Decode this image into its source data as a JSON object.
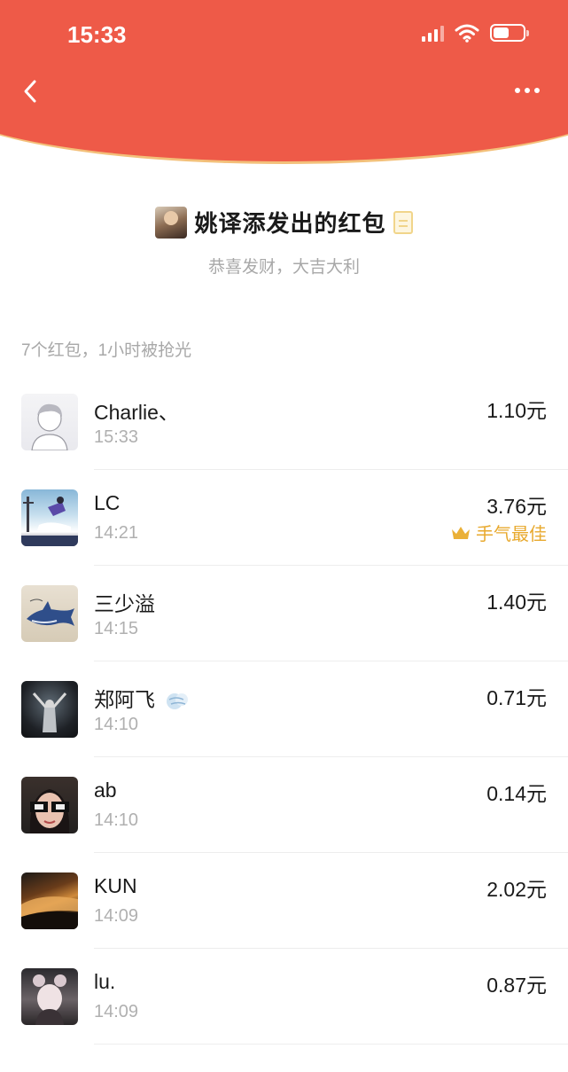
{
  "status_bar": {
    "time": "15:33"
  },
  "header": {
    "title": "姚译添发出的红包",
    "subtitle": "恭喜发财，大吉大利",
    "accent_color": "#ee5a48"
  },
  "summary": "7个红包，1小时被抢光",
  "best_label": "手气最佳",
  "records": [
    {
      "name": "Charlie、",
      "time": "15:33",
      "amount": "1.10元",
      "best": false
    },
    {
      "name": "LC",
      "time": "14:21",
      "amount": "3.76元",
      "best": true
    },
    {
      "name": "三少溢",
      "time": "14:15",
      "amount": "1.40元",
      "best": false
    },
    {
      "name": "郑阿飞",
      "time": "14:10",
      "amount": "0.71元",
      "best": false
    },
    {
      "name": "ab",
      "time": "14:10",
      "amount": "0.14元",
      "best": false
    },
    {
      "name": "KUN",
      "time": "14:09",
      "amount": "2.02元",
      "best": false
    },
    {
      "name": "lu.",
      "time": "14:09",
      "amount": "0.87元",
      "best": false
    }
  ],
  "icons": {
    "back": "chevron-left-icon",
    "more": "more-dots-icon",
    "best": "crown-icon",
    "name_emoji": "wind-emoji-icon"
  }
}
